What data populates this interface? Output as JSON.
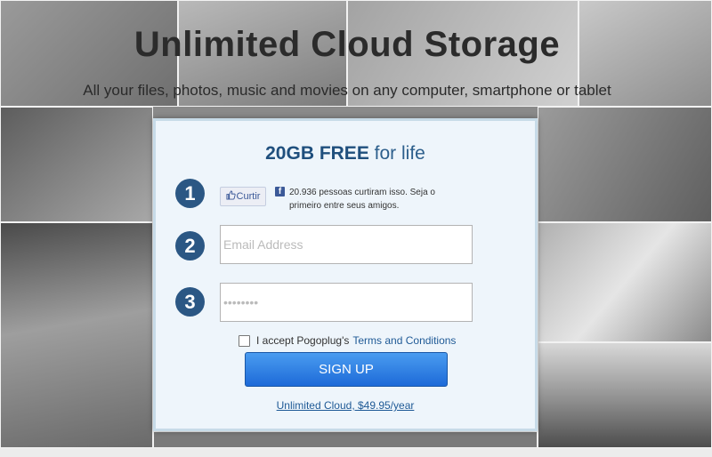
{
  "hero": {
    "title": "Unlimited Cloud Storage",
    "subtitle": "All your files, photos, music and movies on any computer, smartphone or tablet"
  },
  "offer": {
    "emphasis": "20GB FREE",
    "rest": "for life"
  },
  "steps": [
    "1",
    "2",
    "3"
  ],
  "facebook": {
    "like_label": "Curtir",
    "like_icon": "thumbs-up-icon",
    "fb_icon": "f",
    "social_text": "20.936 pessoas curtiram isso. Seja o primeiro entre seus amigos."
  },
  "form": {
    "email_placeholder": "Email Address",
    "password_placeholder": "••••••••",
    "terms_prefix": "I accept Pogoplug's",
    "terms_link": "Terms and Conditions",
    "signup_label": "SIGN UP",
    "plan_link": "Unlimited Cloud, $49.95/year"
  },
  "colors": {
    "step_badge": "#2b5784",
    "button_top": "#4a9cf0",
    "button_bottom": "#1d6ad8",
    "link": "#1f5a96",
    "panel_bg": "#eef5fb"
  }
}
